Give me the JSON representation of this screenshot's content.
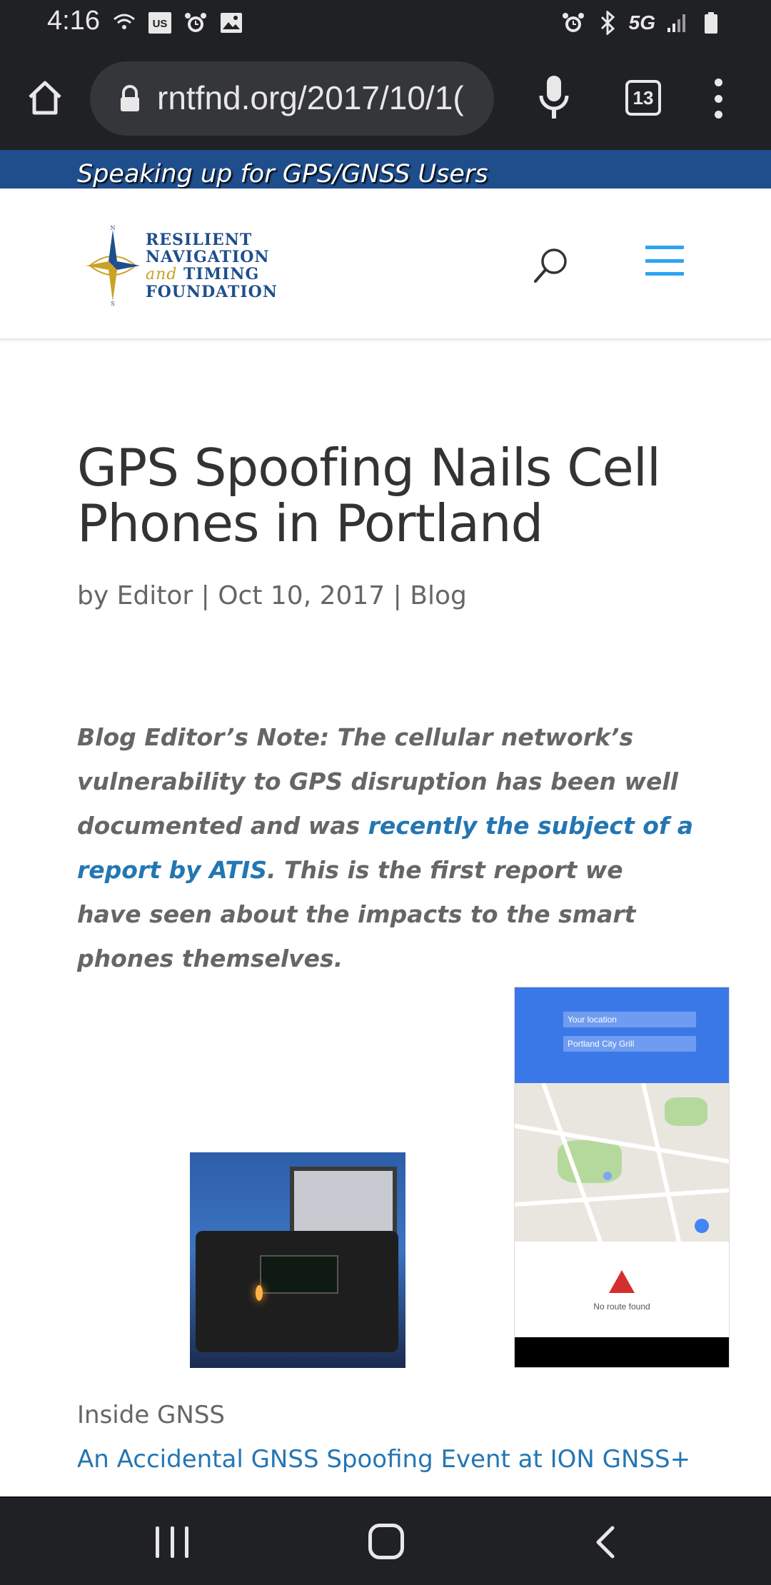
{
  "status_bar": {
    "time": "4:16",
    "network_label": "5G",
    "left_icons": [
      "hotspot-icon",
      "us-carrier-icon",
      "alarm-icon",
      "image-icon"
    ],
    "right_icons": [
      "alarm-icon",
      "bluetooth-icon",
      "5g-icon",
      "signal-icon",
      "battery-icon"
    ]
  },
  "browser": {
    "url": "rntfnd.org/2017/10/1(",
    "tab_count": "13"
  },
  "site": {
    "tagline": "Speaking up for GPS/GNSS Users",
    "logo": {
      "line1": "RESILIENT",
      "line2": "NAVIGATION",
      "line3_and": "and",
      "line3_rest": "TIMING",
      "line4": "FOUNDATION"
    },
    "accent_color": "#2ea3f2",
    "banner_color": "#1f4e8c"
  },
  "article": {
    "title": "GPS Spoofing Nails Cell Phones in Portland",
    "meta": {
      "by": "by",
      "author": "Editor",
      "sep1": "|",
      "date": "Oct 10, 2017",
      "sep2": "|",
      "category": "Blog"
    },
    "note": {
      "before_link": "Blog Editor’s Note: The cellular network’s vulnerability to GPS disruption has been well documented and was ",
      "link_text": "recently the subject of a report by ATIS",
      "after_link": ".  This is the first report we have seen about the impacts to the smart phones themselves."
    },
    "figure": {
      "phone_fields": [
        "Your location",
        "Portland City Grill"
      ],
      "phone_message": "No route found"
    },
    "source": "Inside GNSS",
    "headline_link": "An Accidental GNSS Spoofing Event at ION GNSS+"
  }
}
